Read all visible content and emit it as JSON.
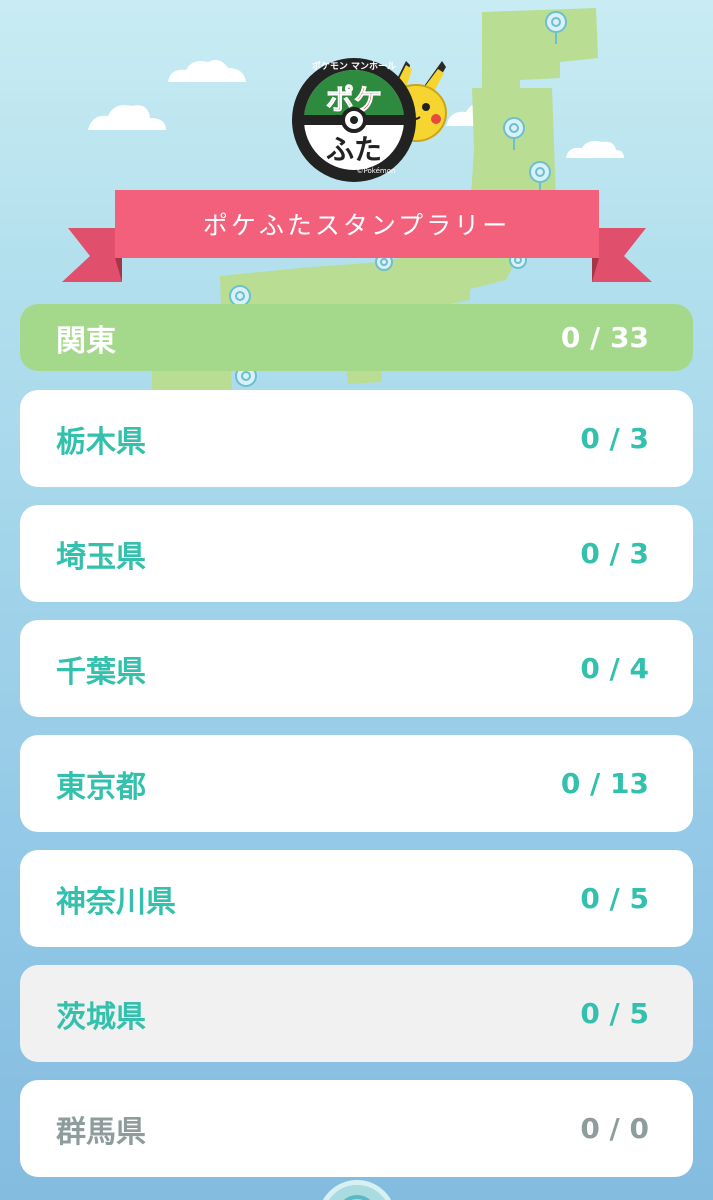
{
  "app": {
    "logo_text_top": "ポケモン マンホール",
    "logo_text_main_top": "ポケ",
    "logo_text_main_bottom": "ふた",
    "logo_copyright": "©Pokémon",
    "title": "ポケふたスタンプラリー"
  },
  "region": {
    "name": "関東",
    "count": "0 / 33"
  },
  "prefectures": [
    {
      "name": "栃木県",
      "count": "0 / 3",
      "state": "normal"
    },
    {
      "name": "埼玉県",
      "count": "0 / 3",
      "state": "normal"
    },
    {
      "name": "千葉県",
      "count": "0 / 4",
      "state": "normal"
    },
    {
      "name": "東京都",
      "count": "0 / 13",
      "state": "normal"
    },
    {
      "name": "神奈川県",
      "count": "0 / 5",
      "state": "normal"
    },
    {
      "name": "茨城県",
      "count": "0 / 5",
      "state": "pressed"
    },
    {
      "name": "群馬県",
      "count": "0 / 0",
      "state": "disabled"
    }
  ],
  "colors": {
    "header_green": "#a4d98c",
    "text_teal": "#33c0ad",
    "text_disabled": "#8f9c9c",
    "ribbon_pink": "#f2607c",
    "map_land": "#b9dd93"
  },
  "icons": {
    "map_pin": "manhole-pin-icon",
    "character": "pikachu-icon",
    "bottom": "pokestop-icon"
  }
}
